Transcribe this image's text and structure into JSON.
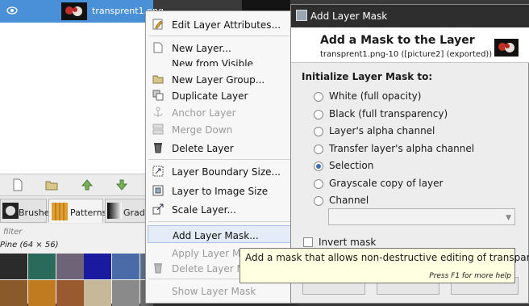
{
  "layers_panel": {
    "layer_name": "transprent1.png",
    "tabs": [
      {
        "label": "Brushes"
      },
      {
        "label": "Patterns"
      },
      {
        "label": "Gradien"
      }
    ],
    "filter_placeholder": "filter",
    "pattern_name": "Pine (64 × 56)"
  },
  "context_menu": {
    "items": [
      {
        "label": "Edit Layer Attributes...",
        "icon": "edit-icon",
        "disabled": false
      },
      {
        "label": "New Layer...",
        "icon": "new-layer-icon",
        "disabled": false
      },
      {
        "label": "New from Visible",
        "icon": "",
        "disabled": false
      },
      {
        "label": "New Layer Group...",
        "icon": "folder-icon",
        "disabled": false
      },
      {
        "label": "Duplicate Layer",
        "icon": "duplicate-icon",
        "disabled": false
      },
      {
        "label": "Anchor Layer",
        "icon": "anchor-icon",
        "disabled": true
      },
      {
        "label": "Merge Down",
        "icon": "merge-down-icon",
        "disabled": true
      },
      {
        "label": "Delete Layer",
        "icon": "delete-icon",
        "disabled": false
      },
      {
        "label": "Layer Boundary Size...",
        "icon": "boundary-size-icon",
        "disabled": false
      },
      {
        "label": "Layer to Image Size",
        "icon": "layer-to-image-icon",
        "disabled": false
      },
      {
        "label": "Scale Layer...",
        "icon": "scale-icon",
        "disabled": false
      },
      {
        "label": "Add Layer Mask...",
        "icon": "",
        "disabled": false
      },
      {
        "label": "Apply Layer Mask",
        "icon": "",
        "disabled": true
      },
      {
        "label": "Delete Layer Mask",
        "icon": "delete-mask-icon",
        "disabled": true
      },
      {
        "label": "Show Layer Mask",
        "icon": "",
        "disabled": true
      }
    ]
  },
  "dialog": {
    "title": "Add Layer Mask",
    "heading": "Add a Mask to the Layer",
    "subheading": "transprent1.png-10 ([picture2] (exported))",
    "section_label": "Initialize Layer Mask to:",
    "options": [
      {
        "label": "White (full opacity)",
        "selected": false
      },
      {
        "label": "Black (full transparency)",
        "selected": false
      },
      {
        "label": "Layer's alpha channel",
        "selected": false
      },
      {
        "label": "Transfer layer's alpha channel",
        "selected": false
      },
      {
        "label": "Selection",
        "selected": true
      },
      {
        "label": "Grayscale copy of layer",
        "selected": false
      },
      {
        "label": "Channel",
        "selected": false
      }
    ],
    "invert_label": "Invert mask"
  },
  "tooltip": {
    "text": "Add a mask that allows non-destructive editing of transparency",
    "hint": "Press F1 for more help"
  }
}
